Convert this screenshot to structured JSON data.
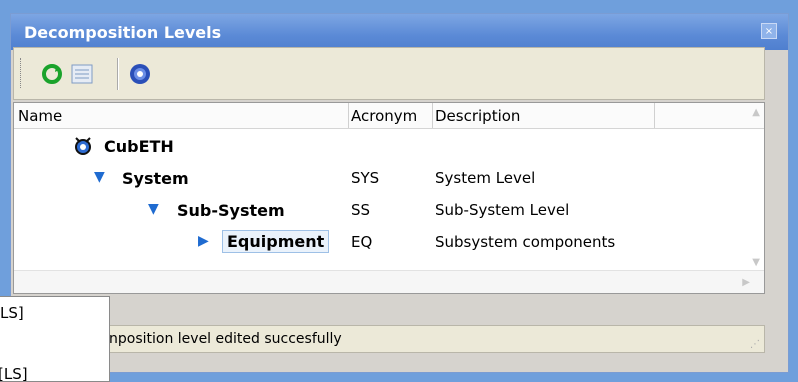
{
  "window": {
    "title": "Decomposition Levels",
    "close_glyph": "×"
  },
  "toolbar": {
    "buttons": [
      {
        "icon": "refresh-icon",
        "color": "#1aa32b"
      },
      {
        "icon": "list-icon",
        "color": "#7f9bc4"
      },
      {
        "icon": "help-icon",
        "color": "#2a4fb8"
      }
    ]
  },
  "grid": {
    "columns": [
      "Name",
      "Acronym",
      "Description"
    ],
    "rows": [
      {
        "name": "CubETH",
        "acronym": "",
        "description": "",
        "level": 0,
        "icon": "satellite-icon"
      },
      {
        "name": "System",
        "acronym": "SYS",
        "description": "System Level",
        "level": 1,
        "icon": "expanded-triangle-icon"
      },
      {
        "name": "Sub-System",
        "acronym": "SS",
        "description": "Sub-System Level",
        "level": 2,
        "icon": "expanded-triangle-icon"
      },
      {
        "name": "Equipment",
        "acronym": "EQ",
        "description": "Subsystem components",
        "level": 3,
        "icon": "collapsed-triangle-icon",
        "editing": true
      }
    ]
  },
  "status": {
    "message": "nposition level edited succesfully"
  },
  "popup": {
    "items": [
      "LS]",
      "[LS]"
    ]
  },
  "colors": {
    "titlebar": "#5b8ad6",
    "background": "#6f9fdc",
    "tree_triangle": "#1f6bd0"
  }
}
